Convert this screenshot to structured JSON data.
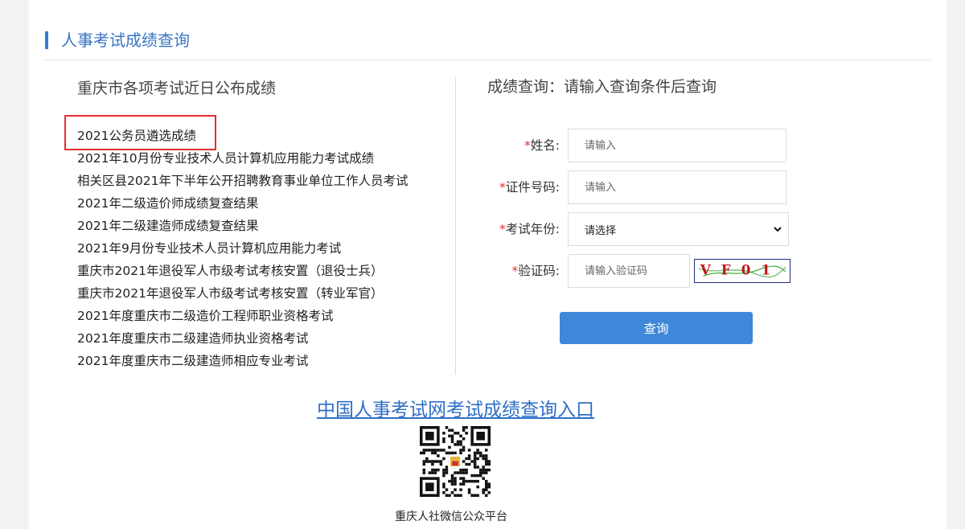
{
  "section": {
    "title": "人事考试成绩查询"
  },
  "left": {
    "title": "重庆市各项考试近日公布成绩",
    "items": [
      "2021公务员遴选成绩",
      "2021年10月份专业技术人员计算机应用能力考试成绩",
      "相关区县2021年下半年公开招聘教育事业单位工作人员考试",
      "2021年二级造价师成绩复查结果",
      "2021年二级建造师成绩复查结果",
      "2021年9月份专业技术人员计算机应用能力考试",
      "重庆市2021年退役军人市级考试考核安置（退役士兵）",
      "重庆市2021年退役军人市级考试考核安置（转业军官）",
      "2021年度重庆市二级造价工程师职业资格考试",
      "2021年度重庆市二级建造师执业资格考试",
      "2021年度重庆市二级建造师相应专业考试"
    ]
  },
  "form": {
    "title": "成绩查询：请输入查询条件后查询",
    "required_mark": "*",
    "name_label": "姓名:",
    "name_placeholder": "请输入",
    "id_label": "证件号码:",
    "id_placeholder": "请输入",
    "year_label": "考试年份:",
    "year_selected": "请选择",
    "captcha_label": "验证码:",
    "captcha_placeholder": "请输入验证码",
    "captcha_text": "VF01",
    "submit_label": "查询"
  },
  "portal_link": "中国人事考试网考试成绩查询入口",
  "qr_caption": "重庆人社微信公众平台",
  "colors": {
    "accent": "#3f87d9",
    "title_blue": "#3a74c4",
    "link_blue": "#2f6fc7",
    "required_red": "#e52e2e",
    "highlight_red": "#e52e2e"
  }
}
